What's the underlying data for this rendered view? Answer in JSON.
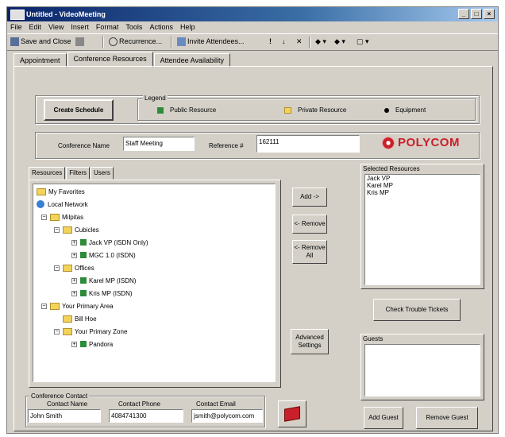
{
  "window": {
    "title": "Untitled - VideoMeeting"
  },
  "window_controls": [
    "_",
    "□",
    "×"
  ],
  "menu": [
    "File",
    "Edit",
    "View",
    "Insert",
    "Format",
    "Tools",
    "Actions",
    "Help"
  ],
  "toolbar": {
    "save_close": "Save and Close",
    "recurrence": "Recurrence...",
    "invite": "Invite Attendees..."
  },
  "tabs": [
    "Appointment",
    "Conference Resources",
    "Attendee Availability"
  ],
  "create_schedule": "Create Schedule",
  "legend": {
    "title": "Legend",
    "items": [
      {
        "label": "Public Resource",
        "color": "#2e8b3a"
      },
      {
        "label": "Private Resource",
        "color": "#f3d35a"
      },
      {
        "label": "Equipment",
        "color": "#000000"
      }
    ]
  },
  "conference_name": {
    "label": "Conference Name",
    "value": "Staff Meeting"
  },
  "reference": {
    "label": "Reference #",
    "value": "162111"
  },
  "brand": {
    "name": "POLYCOM",
    "color": "#c9202a"
  },
  "resource_tabs": [
    "Resources",
    "Filters",
    "Users"
  ],
  "tree": [
    {
      "label": "My Favorites",
      "level": 0,
      "icon": "folder"
    },
    {
      "label": "Local Network",
      "level": 0,
      "icon": "network"
    },
    {
      "label": "Milpitas",
      "level": 1,
      "icon": "folder",
      "expander": "−"
    },
    {
      "label": "Cubicles",
      "level": 2,
      "icon": "folder",
      "expander": "−"
    },
    {
      "label": "Jack VP (ISDN Only)",
      "level": 3,
      "icon": "node",
      "expander": "+"
    },
    {
      "label": "MGC 1.0 (ISDN)",
      "level": 3,
      "icon": "node",
      "expander": "+"
    },
    {
      "label": "Offices",
      "level": 2,
      "icon": "folder",
      "expander": "−"
    },
    {
      "label": "Karel MP (ISDN)",
      "level": 3,
      "icon": "node",
      "expander": "+"
    },
    {
      "label": "Kris MP (ISDN)",
      "level": 3,
      "icon": "node",
      "expander": "+"
    },
    {
      "label": "Your Primary Area",
      "level": 1,
      "icon": "folder",
      "expander": "−"
    },
    {
      "label": "Bill Hoe",
      "level": 2,
      "icon": "folder"
    },
    {
      "label": "Your Primary Zone",
      "level": 2,
      "icon": "folder",
      "expander": "−"
    },
    {
      "label": "Pandora",
      "level": 3,
      "icon": "node",
      "expander": "+"
    }
  ],
  "buttons": {
    "add": "Add ->",
    "remove": "<- Remove",
    "remove_all": "<- Remove All",
    "advanced": "Advanced Settings",
    "check_tickets": "Check Trouble Tickets",
    "add_guest": "Add Guest",
    "remove_guest": "Remove Guest"
  },
  "selected_resources": {
    "title": "Selected Resources",
    "items": [
      "Jack VP",
      "Karel MP",
      "Kris MP"
    ]
  },
  "guests": {
    "title": "Guests"
  },
  "contact": {
    "title": "Conference Contact",
    "name_label": "Contact Name",
    "phone_label": "Contact Phone",
    "email_label": "Contact Email",
    "name": "John Smith",
    "phone": "4084741300",
    "email": "jsmith@polycom.com"
  }
}
